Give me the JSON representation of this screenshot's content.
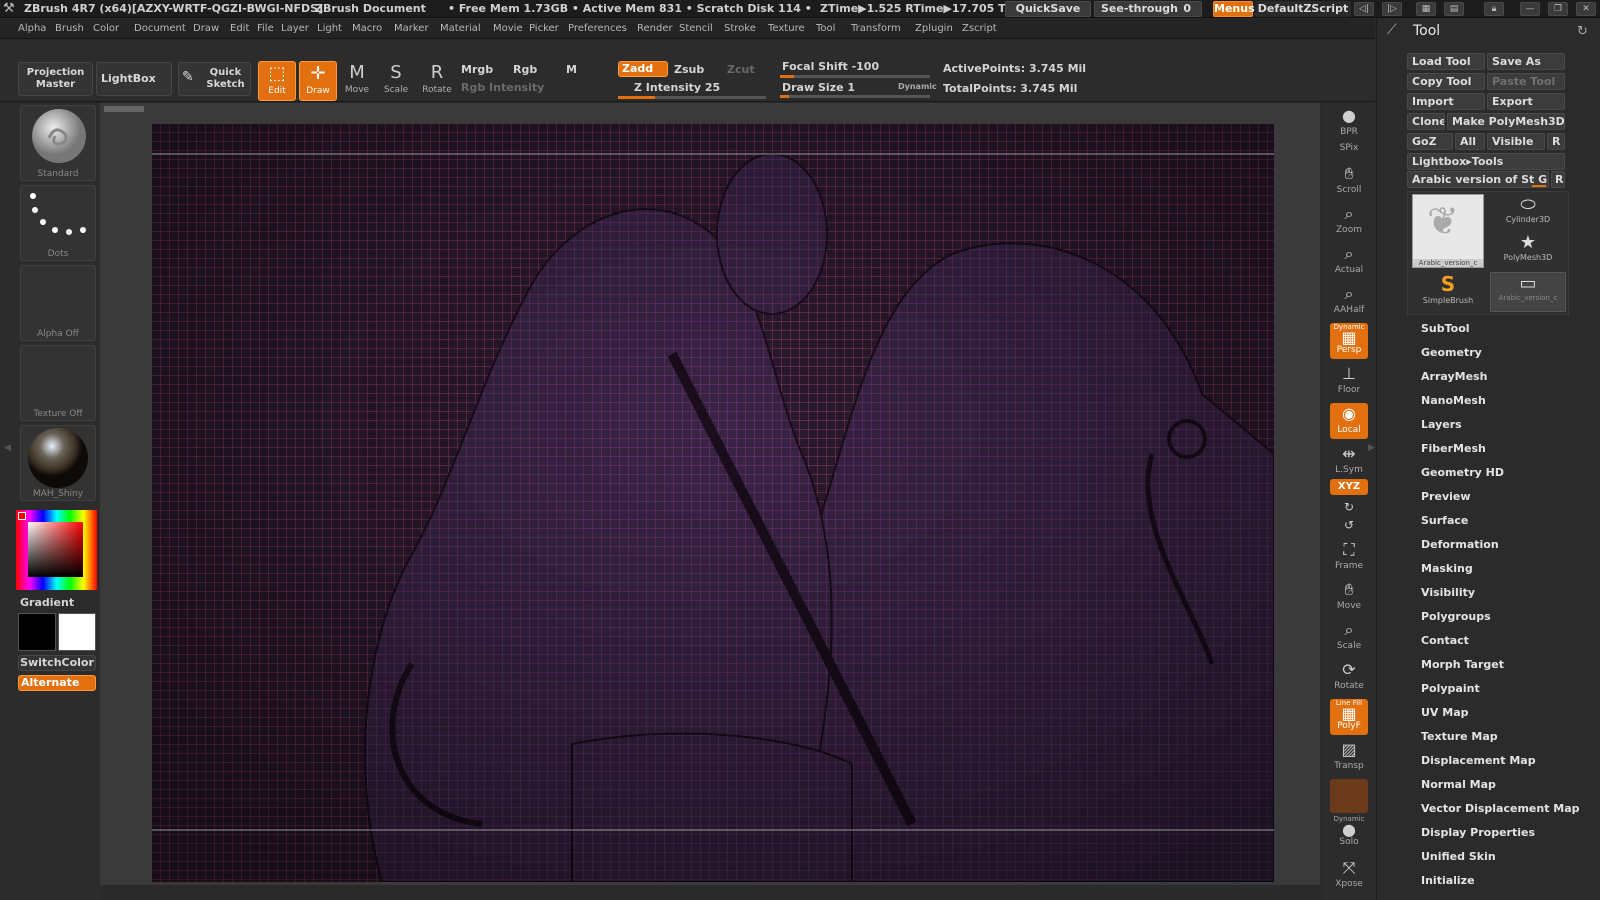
{
  "titlebar": {
    "app_title": "ZBrush 4R7 (x64)[AZXY-WRTF-QGZI-BWGI-NFDS]",
    "doc_label": "ZBrush Document",
    "stats": "• Free Mem 1.73GB • Active Mem 831 • Scratch Disk 114 •",
    "ztime": "ZTime▶1.525 RTime▶17.705 T",
    "quicksave": "QuickSave",
    "see_through": "See-through",
    "see_through_value": "0",
    "menus": "Menus",
    "script": "DefaultZScript"
  },
  "menubar": [
    "Alpha",
    "Brush",
    "Color",
    "Document",
    "Draw",
    "Edit",
    "File",
    "Layer",
    "Light",
    "Macro",
    "Marker",
    "Material",
    "Movie",
    "Picker",
    "Preferences",
    "Render",
    "Stencil",
    "Stroke",
    "Texture",
    "Tool",
    "Transform",
    "Zplugin",
    "Zscript"
  ],
  "toolbar": {
    "projection_master": "Projection Master",
    "lightbox": "LightBox",
    "quick_sketch": "Quick Sketch",
    "edit": "Edit",
    "draw": "Draw",
    "move": "Move",
    "scale": "Scale",
    "rotate": "Rotate",
    "mrgb": "Mrgb",
    "rgb": "Rgb",
    "m": "M",
    "rgb_intensity": "Rgb Intensity",
    "zadd": "Zadd",
    "zsub": "Zsub",
    "zcut": "Zcut",
    "z_intensity": "Z Intensity 25",
    "focal_shift": "Focal Shift -100",
    "draw_size": "Draw Size 1",
    "dynamic": "Dynamic",
    "active_points": "ActivePoints: 3.745 Mil",
    "total_points": "TotalPoints: 3.745 Mil",
    "z_intensity_level": 0.25,
    "draw_size_level": 0.02
  },
  "leftshelf": {
    "brush": "Standard",
    "stroke": "Dots",
    "alpha": "Alpha Off",
    "texture": "Texture Off",
    "material": "MAH_Shiny",
    "gradient": "Gradient",
    "switchcolor": "SwitchColor",
    "alternate": "Alternate"
  },
  "rightshelf": [
    "BPR",
    "SPix",
    "Scroll",
    "Zoom",
    "Actual",
    "AAHalf",
    "Persp",
    "Floor",
    "Local",
    "L.Sym",
    "XYZ",
    "Frame",
    "Move",
    "Scale",
    "Rotate",
    "PolyF",
    "Transp",
    "Solo",
    "Xpose"
  ],
  "rightshelf_extra": {
    "dynamic": "Dynamic",
    "linefill": "Line Fill"
  },
  "toolpanel": {
    "title": "Tool",
    "load_tool": "Load Tool",
    "save_as": "Save As",
    "copy_tool": "Copy Tool",
    "paste_tool": "Paste Tool",
    "import": "Import",
    "export": "Export",
    "clone": "Clone",
    "make_polymesh": "Make PolyMesh3D",
    "goz": "GoZ",
    "all": "All",
    "visible": "Visible",
    "r": "R",
    "lightbox_tools": "Lightbox▸Tools",
    "current_tool": "Arabic version of St G",
    "thumbs": [
      "Arabic_version_c",
      "Cylinder3D",
      "PolyMesh3D",
      "SimpleBrush",
      "Arabic_version_c"
    ],
    "sections": [
      "SubTool",
      "Geometry",
      "ArrayMesh",
      "NanoMesh",
      "Layers",
      "FiberMesh",
      "Geometry HD",
      "Preview",
      "Surface",
      "Deformation",
      "Masking",
      "Visibility",
      "Polygroups",
      "Contact",
      "Morph Target",
      "Polypaint",
      "UV Map",
      "Texture Map",
      "Displacement Map",
      "Normal Map",
      "Vector Displacement Map",
      "Display Properties",
      "Unified Skin",
      "Initialize"
    ]
  }
}
